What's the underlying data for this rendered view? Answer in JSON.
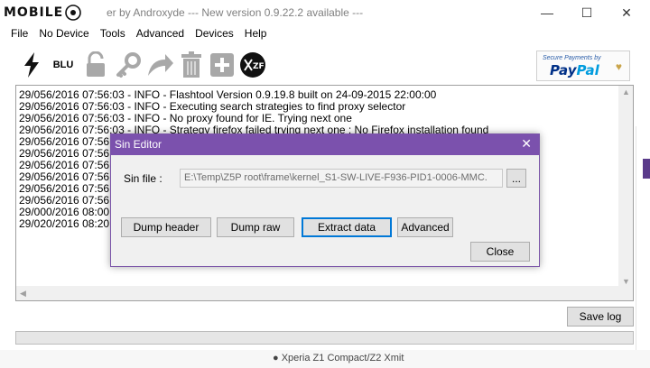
{
  "watermark": {
    "text": "MOBILE"
  },
  "window": {
    "title": "er by Androxyde   --- New version 0.9.22.2 available ---",
    "minimize": "—",
    "maximize": "☐",
    "close": "✕"
  },
  "menu": [
    "File",
    "No Device",
    "Tools",
    "Advanced",
    "Devices",
    "Help"
  ],
  "toolbar": {
    "blu_label": "BLU",
    "icons": [
      "flash-icon",
      "blu-icon",
      "unlock-icon",
      "key-icon",
      "arrow-icon",
      "trash-icon",
      "add-icon",
      "xperia-icon"
    ]
  },
  "paypal": {
    "tagline": "Secure Payments by",
    "logo_a": "Pay",
    "logo_b": "Pal",
    "heart": "♥"
  },
  "log": [
    "29/056/2016 07:56:03 - INFO  - Flashtool Version 0.9.19.8 built on 24-09-2015 22:00:00",
    "29/056/2016 07:56:03 - INFO  - Executing search strategies to find proxy selector",
    "29/056/2016 07:56:03 - INFO  - No proxy found for IE. Trying next one",
    "29/056/2016 07:56:03 - INFO  - Strategy firefox failed trying next one : No Firefox installation found",
    "29/056/2016 07:56:0",
    "29/056/2016 07:56:0",
    "29/056/2016 07:56:0",
    "29/056/2016 07:56:1",
    "29/056/2016 07:56:1",
    "29/056/2016 07:56:1",
    "29/000/2016 08:00:2",
    "29/020/2016 08:20:2"
  ],
  "buttons": {
    "save_log": "Save log"
  },
  "background": {
    "bottom_text": "●  Xperia Z1 Compact/Z2 Xmit"
  },
  "colors": {
    "dialog_title": "#7b51ad",
    "accent": "#0078d7"
  },
  "dialog": {
    "title": "Sin Editor",
    "close": "✕",
    "sin_label": "Sin file :",
    "sin_value": "E:\\Temp\\Z5P root\\frame\\kernel_S1-SW-LIVE-F936-PID1-0006-MMC.",
    "browse": "...",
    "dump_header": "Dump header",
    "dump_raw": "Dump raw",
    "extract": "Extract data",
    "advanced": "Advanced",
    "close_btn": "Close"
  }
}
